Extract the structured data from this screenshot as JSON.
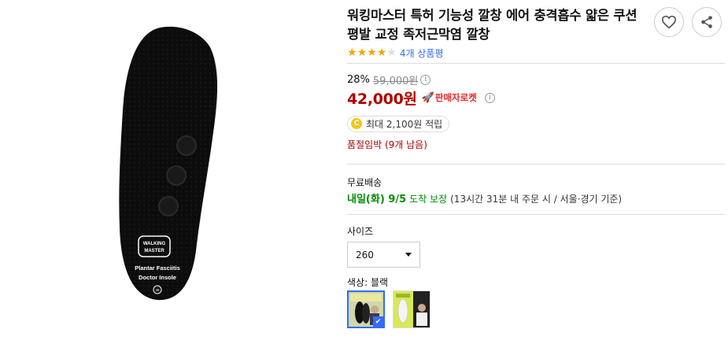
{
  "product": {
    "title": "워킹마스터 특허 기능성 깔창 에어 충격흡수 얇은 쿠션 평발 교정 족저근막염 깔창",
    "rating_fraction": 0.8,
    "review_count_text": "4개 상품평",
    "image_print": {
      "brand_line1": "WALKING",
      "brand_line2": "MASTER",
      "line1": "Plantar Fasciitis",
      "line2": "Doctor Insole",
      "size_mark": "38"
    }
  },
  "price": {
    "discount_rate": "28%",
    "original_price": "59,000원",
    "sale_price": "42,000원",
    "rocket_label": "판매자로켓",
    "info_glyph": "i"
  },
  "cash": {
    "coin_letter": "C",
    "text": "최대 2,100원 적립"
  },
  "stock": {
    "warning": "품절임박 (9개 남음)"
  },
  "shipping": {
    "label": "무료배송",
    "date": "내일(화) 9/5",
    "guarantee": "도착 보장",
    "note": "(13시간 31분  내 주문 시 / 서울·경기 기준)"
  },
  "options": {
    "size_label": "사이즈",
    "size_value": "260",
    "color_label_prefix": "색상:",
    "color_value": "블랙"
  },
  "colors": {
    "accent": "#346aff",
    "price_red": "#ae0000",
    "rocket_red": "#e52528",
    "delivery_green": "#008c00",
    "star": "#f7a500"
  }
}
